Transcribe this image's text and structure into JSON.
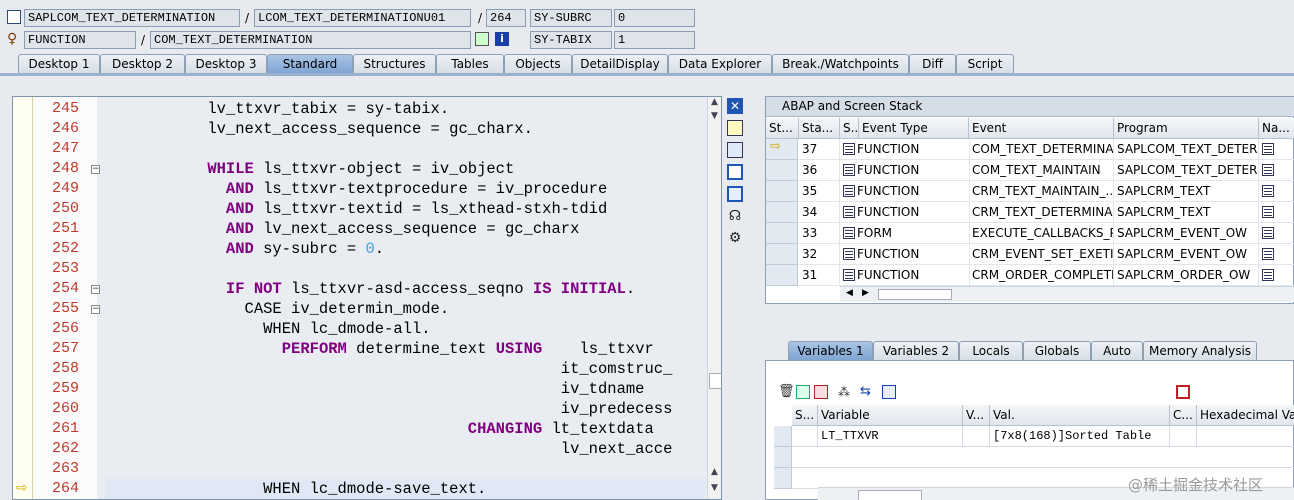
{
  "header": {
    "program": "SAPLCOM_TEXT_DETERMINATION",
    "include": "LCOM_TEXT_DETERMINATIONU01",
    "line": "264",
    "var1_name": "SY-SUBRC",
    "var1_value": "0",
    "type": "FUNCTION",
    "name": "COM_TEXT_DETERMINATION",
    "var2_name": "SY-TABIX",
    "var2_value": "1",
    "slash1": "/",
    "slash2": "/",
    "slash3": "/"
  },
  "tabs": [
    "Desktop 1",
    "Desktop 2",
    "Desktop 3",
    "Standard",
    "Structures",
    "Tables",
    "Objects",
    "DetailDisplay",
    "Data Explorer",
    "Break./Watchpoints",
    "Diff",
    "Script"
  ],
  "active_tab": "Standard",
  "editor": {
    "line_numbers": [
      "245",
      "246",
      "247",
      "248",
      "249",
      "250",
      "251",
      "252",
      "253",
      "254",
      "255",
      "256",
      "257",
      "258",
      "259",
      "260",
      "261",
      "262",
      "263",
      "264"
    ],
    "current_line": "264"
  },
  "stack": {
    "title": "ABAP and Screen Stack",
    "columns": [
      "St...",
      "Sta...",
      "S...",
      "Event Type",
      "Event",
      "Program",
      "Na..."
    ],
    "rows": [
      {
        "level": "37",
        "type": "FUNCTION",
        "event": "COM_TEXT_DETERMINA...",
        "program": "SAPLCOM_TEXT_DETER..."
      },
      {
        "level": "36",
        "type": "FUNCTION",
        "event": "COM_TEXT_MAINTAIN",
        "program": "SAPLCOM_TEXT_DETER..."
      },
      {
        "level": "35",
        "type": "FUNCTION",
        "event": "CRM_TEXT_MAINTAIN_...",
        "program": "SAPLCRM_TEXT"
      },
      {
        "level": "34",
        "type": "FUNCTION",
        "event": "CRM_TEXT_DETERMINA...",
        "program": "SAPLCRM_TEXT"
      },
      {
        "level": "33",
        "type": "FORM",
        "event": "EXECUTE_CALLBACKS_P...",
        "program": "SAPLCRM_EVENT_OW"
      },
      {
        "level": "32",
        "type": "FUNCTION",
        "event": "CRM_EVENT_SET_EXETI...",
        "program": "SAPLCRM_EVENT_OW"
      },
      {
        "level": "31",
        "type": "FUNCTION",
        "event": "CRM_ORDER_COMPLETE...",
        "program": "SAPLCRM_ORDER_OW"
      }
    ]
  },
  "var_tabs": [
    "Variables 1",
    "Variables 2",
    "Locals",
    "Globals",
    "Auto",
    "Memory Analysis"
  ],
  "variables": {
    "columns": [
      "S...",
      "Variable",
      "V...",
      "Val.",
      "C...",
      "Hexadecimal Value"
    ],
    "rows": [
      {
        "name": "LT_TTXVR",
        "value": "[7x8(168)]Sorted Table"
      }
    ]
  },
  "watermark": "@稀土掘金技术社区"
}
